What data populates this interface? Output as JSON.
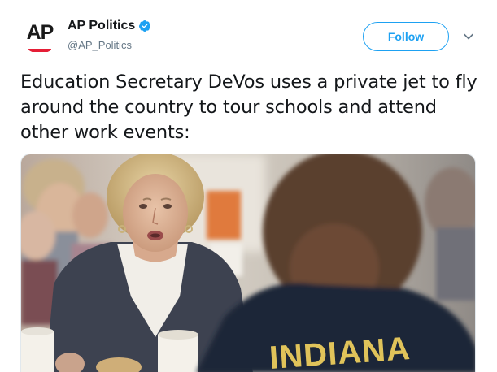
{
  "account": {
    "avatar_logo_text": "AP",
    "display_name": "AP Politics",
    "handle": "@AP_Politics",
    "verified": true,
    "verified_icon": "verified-badge-icon"
  },
  "actions": {
    "follow_label": "Follow",
    "more_icon": "chevron-down-icon"
  },
  "tweet": {
    "text": "Education Secretary DeVos uses a private jet to fly around the country to tour schools and attend other work events:"
  },
  "media": {
    "shirt_text": "INDIANA"
  },
  "colors": {
    "accent": "#1da1f2",
    "ap_red": "#e51e36",
    "text_primary": "#14171a",
    "text_secondary": "#657786"
  }
}
